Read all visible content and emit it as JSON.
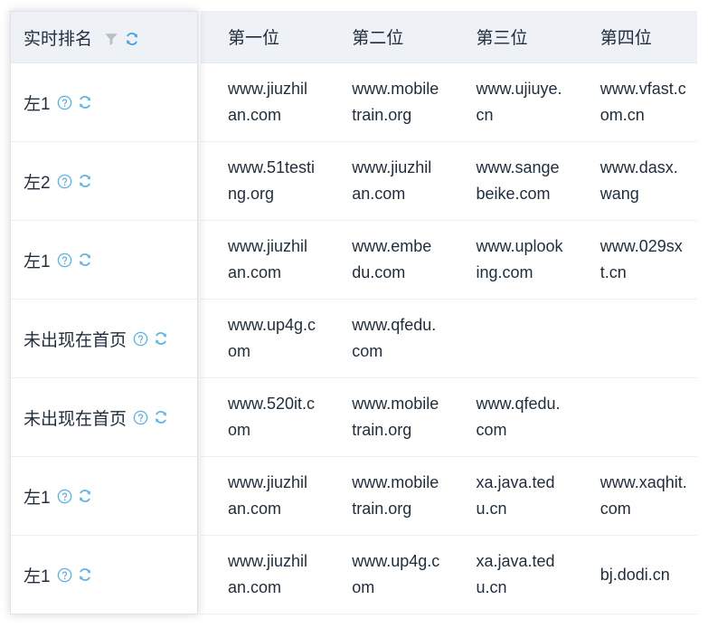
{
  "table": {
    "fixed_column": {
      "header": {
        "label": "实时排名",
        "filter_icon": "filter-icon",
        "refresh_icon": "refresh-icon"
      },
      "row_icons": {
        "help_icon": "help-icon",
        "refresh_icon": "refresh-icon"
      },
      "rows": [
        {
          "label": "左1"
        },
        {
          "label": "左2"
        },
        {
          "label": "左1"
        },
        {
          "label": "未出现在首页"
        },
        {
          "label": "未出现在首页"
        },
        {
          "label": "左1"
        },
        {
          "label": "左1"
        }
      ]
    },
    "columns": [
      {
        "label": "第一位"
      },
      {
        "label": "第二位"
      },
      {
        "label": "第三位"
      },
      {
        "label": "第四位"
      }
    ],
    "rows": [
      [
        "www.jiuzhilan.com",
        "www.mobiletrain.org",
        "www.ujiuye.cn",
        "www.vfast.com.cn"
      ],
      [
        "www.51testing.org",
        "www.jiuzhilan.com",
        "www.sangebeike.com",
        "www.dasx.wang"
      ],
      [
        "www.jiuzhilan.com",
        "www.embedu.com",
        "www.uplooking.com",
        "www.029sxt.cn"
      ],
      [
        "www.up4g.com",
        "www.qfedu.com",
        "",
        ""
      ],
      [
        "www.520it.com",
        "www.mobiletrain.org",
        "www.qfedu.com",
        ""
      ],
      [
        "www.jiuzhilan.com",
        "www.mobiletrain.org",
        "xa.java.tedu.cn",
        "www.xaqhit.com"
      ],
      [
        "www.jiuzhilan.com",
        "www.up4g.com",
        "xa.java.tedu.cn",
        "bj.dodi.cn"
      ]
    ]
  },
  "colors": {
    "header_background": "#eef1f6",
    "text": "#1f2d3d",
    "accent_blue": "#3a9fe8",
    "icon_blue": "#59b0ec",
    "filter_gray": "#b9bec6",
    "row_border": "#ebeef5",
    "panel_border": "#dfe2e7"
  }
}
